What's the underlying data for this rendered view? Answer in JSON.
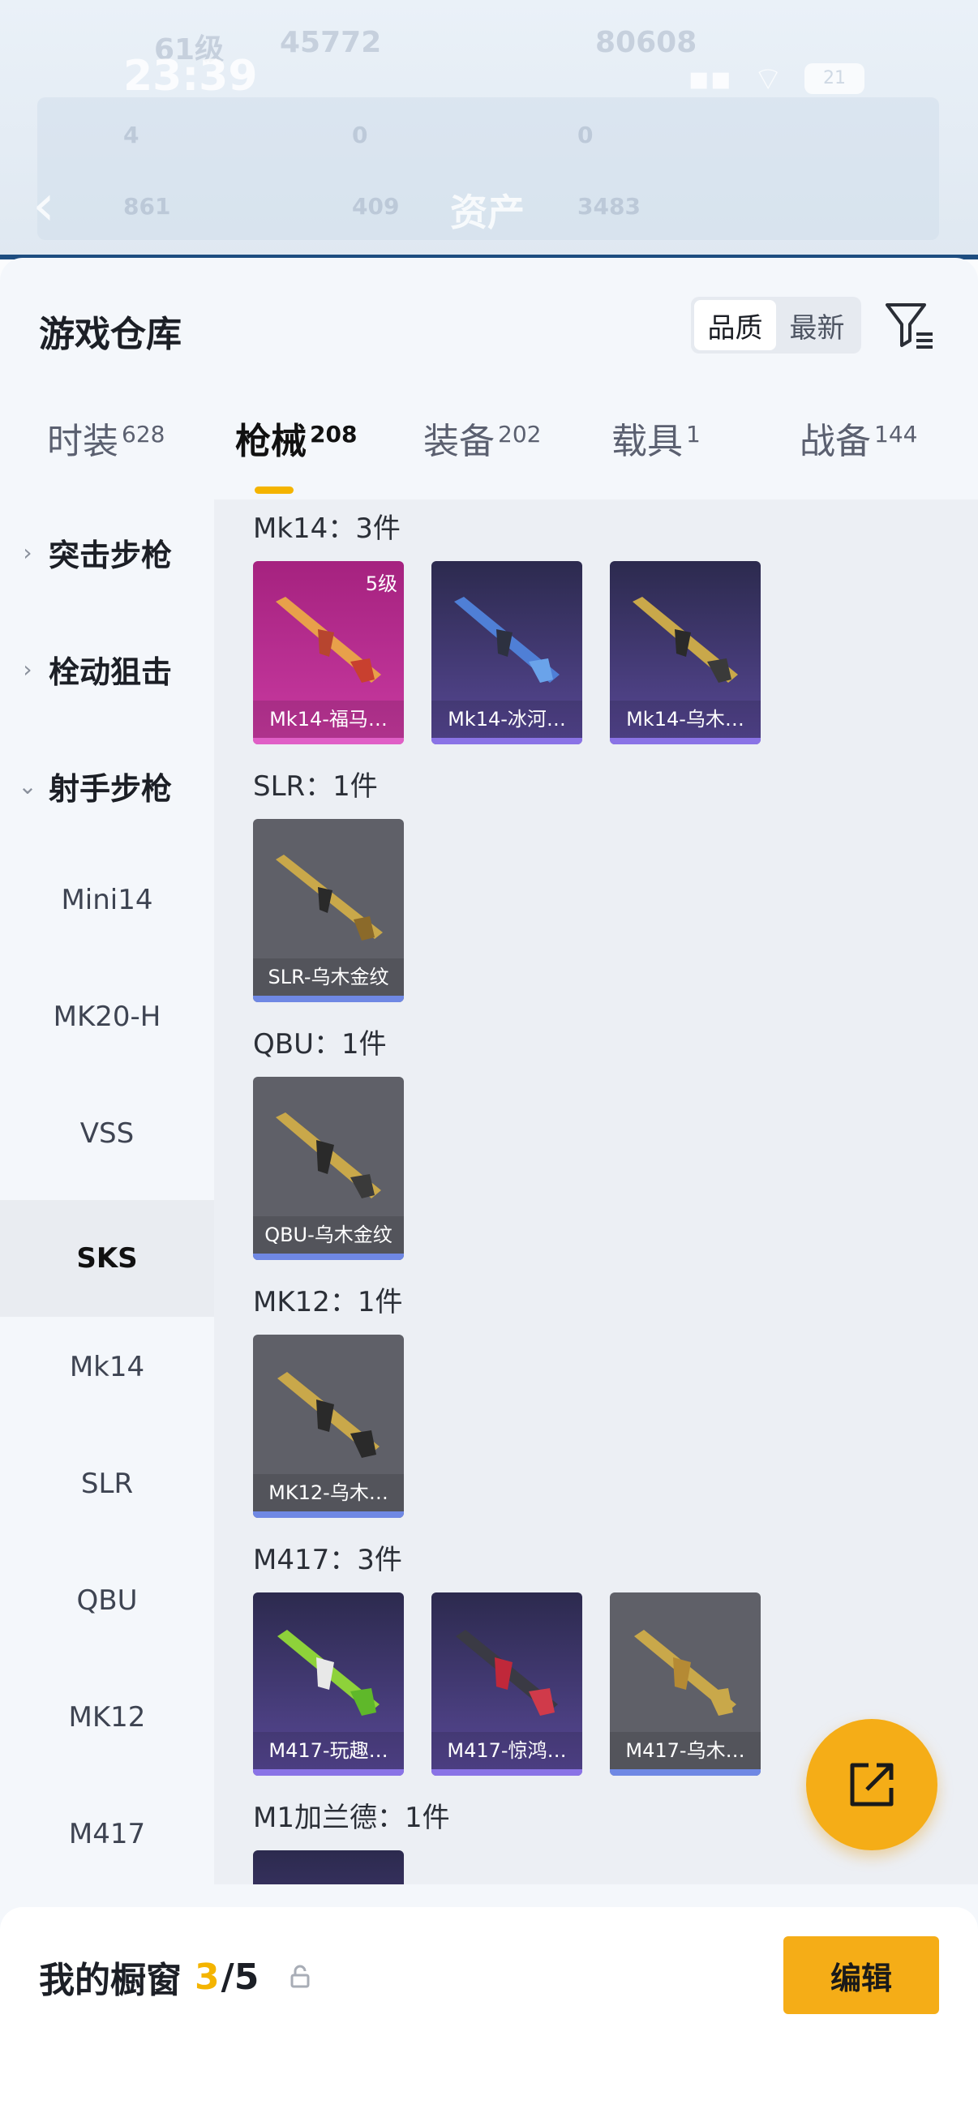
{
  "status_bar": {
    "time": "23:39",
    "battery": "21"
  },
  "header": {
    "title": "资产",
    "back_icon": "chevron-left-icon"
  },
  "background_stats": {
    "level": "61级",
    "points": "45772",
    "score": "80608",
    "stat_a": "4",
    "stat_b": "0",
    "stat_c": "0",
    "stat_d": "861",
    "stat_e": "409",
    "stat_f": "3483"
  },
  "warehouse": {
    "title": "游戏仓库",
    "sort_options": [
      "品质",
      "最新"
    ],
    "sort_selected": "品质",
    "tabs": [
      {
        "label": "时装",
        "count": "628"
      },
      {
        "label": "枪械",
        "count": "208"
      },
      {
        "label": "装备",
        "count": "202"
      },
      {
        "label": "载具",
        "count": "1"
      },
      {
        "label": "战备",
        "count": "144"
      }
    ],
    "active_tab": "枪械"
  },
  "sidebar": {
    "categories": [
      {
        "label": "突击步枪",
        "expanded": false
      },
      {
        "label": "栓动狙击",
        "expanded": false
      },
      {
        "label": "射手步枪",
        "expanded": true
      }
    ],
    "sub_items": [
      "Mini14",
      "MK20-H",
      "VSS",
      "SKS",
      "Mk14",
      "SLR",
      "QBU",
      "MK12",
      "M417"
    ],
    "selected": "SKS"
  },
  "groups": [
    {
      "header": "Mk14：3件",
      "items": [
        {
          "name": "Mk14-福马…",
          "rarity": "pink",
          "level": "5级"
        },
        {
          "name": "Mk14-冰河…",
          "rarity": "purple"
        },
        {
          "name": "Mk14-乌木…",
          "rarity": "purple"
        }
      ]
    },
    {
      "header": "SLR：1件",
      "items": [
        {
          "name": "SLR-乌木金纹",
          "rarity": "gray"
        }
      ]
    },
    {
      "header": "QBU：1件",
      "items": [
        {
          "name": "QBU-乌木金纹",
          "rarity": "gray"
        }
      ]
    },
    {
      "header": "MK12：1件",
      "items": [
        {
          "name": "MK12-乌木…",
          "rarity": "gray"
        }
      ]
    },
    {
      "header": "M417：3件",
      "items": [
        {
          "name": "M417-玩趣…",
          "rarity": "purple"
        },
        {
          "name": "M417-惊鸿…",
          "rarity": "purple"
        },
        {
          "name": "M417-乌木…",
          "rarity": "gray"
        }
      ]
    },
    {
      "header": "M1加兰德：1件",
      "items": [
        {
          "name": "",
          "rarity": "purple"
        }
      ]
    }
  ],
  "showcase": {
    "label": "我的橱窗",
    "count": "3",
    "total": "/5",
    "edit_label": "编辑"
  },
  "colors": {
    "accent": "#f4b400",
    "button": "#f5ad17",
    "pink_rarity": "#c93aa1",
    "purple_rarity": "#584896",
    "gray_rarity": "#5f6068"
  }
}
